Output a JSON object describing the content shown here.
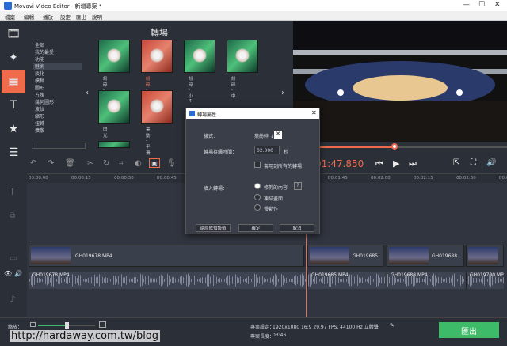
{
  "window": {
    "title": "Movavi Video Editor - 新增專案 *"
  },
  "menu": [
    "檔案",
    "編輯",
    "播放",
    "設定",
    "匯出",
    "說明"
  ],
  "transitions": {
    "heading": "轉場",
    "categories": [
      "全部",
      "我的最愛",
      "功能",
      "魅術",
      "淡化",
      "模糊",
      "圖形",
      "方塊",
      "幾何圖形",
      "波紋",
      "縮形",
      "扭轉",
      "擴散"
    ],
    "selected_category": "魅術",
    "thumbs": [
      {
        "label": "紛碎 - 大",
        "style": "green"
      },
      {
        "label": "紛碎 - 大 ↓",
        "style": "red",
        "selected": true
      },
      {
        "label": "紛碎 - 小↑",
        "style": "green"
      },
      {
        "label": "紛碎 - 中",
        "style": "green"
      },
      {
        "label": "閃光",
        "style": "green"
      },
      {
        "label": "葉動 - 平滑",
        "style": "red"
      },
      {
        "label": "",
        "style": "green"
      }
    ]
  },
  "player": {
    "timecode": "01:47.850"
  },
  "ruler": [
    "00:00:00",
    "00:00:15",
    "00:00:30",
    "00:00:45",
    "00:01:00",
    "00:01:15",
    "00:01:30",
    "00:01:45",
    "00:02:00",
    "00:02:15",
    "00:02:30",
    "00:02:45"
  ],
  "dialog": {
    "title": "轉場屬性",
    "style_label": "樣式：",
    "style_value": "葉紛碎 ↓",
    "duration_label": "轉場持續時間：",
    "duration_value": "02.000",
    "duration_unit": "秒",
    "apply_all": "套用到所有的轉場",
    "fill_label": "填入轉場：",
    "options": [
      "修剪的內容",
      "凍結畫面",
      "慢動作"
    ],
    "selected_option": "修剪的內容",
    "help": "?",
    "reset": "還原成預設值",
    "ok": "確定",
    "cancel": "取消"
  },
  "timeline": {
    "clips": [
      "GH019678.MP4",
      "GH019685.",
      "GH019688.",
      "GH0196"
    ],
    "audio_clips": [
      "GH019678.MP4",
      "GH019685.MP4",
      "GH019688.MP4",
      "GH019700.MP4"
    ]
  },
  "status": {
    "zoom_label": "縮放：",
    "project_settings_label": "專案設定：",
    "project_settings_value": "1920x1080 16:9 29.97 FPS, 44100 Hz 立體聲",
    "project_length_label": "專案長度：",
    "project_length_value": "03:46",
    "export": "匯出"
  },
  "watermark": "http://hardaway.com.tw/blog",
  "colors": {
    "accent": "#f06a4c",
    "export": "#3dbb68"
  }
}
